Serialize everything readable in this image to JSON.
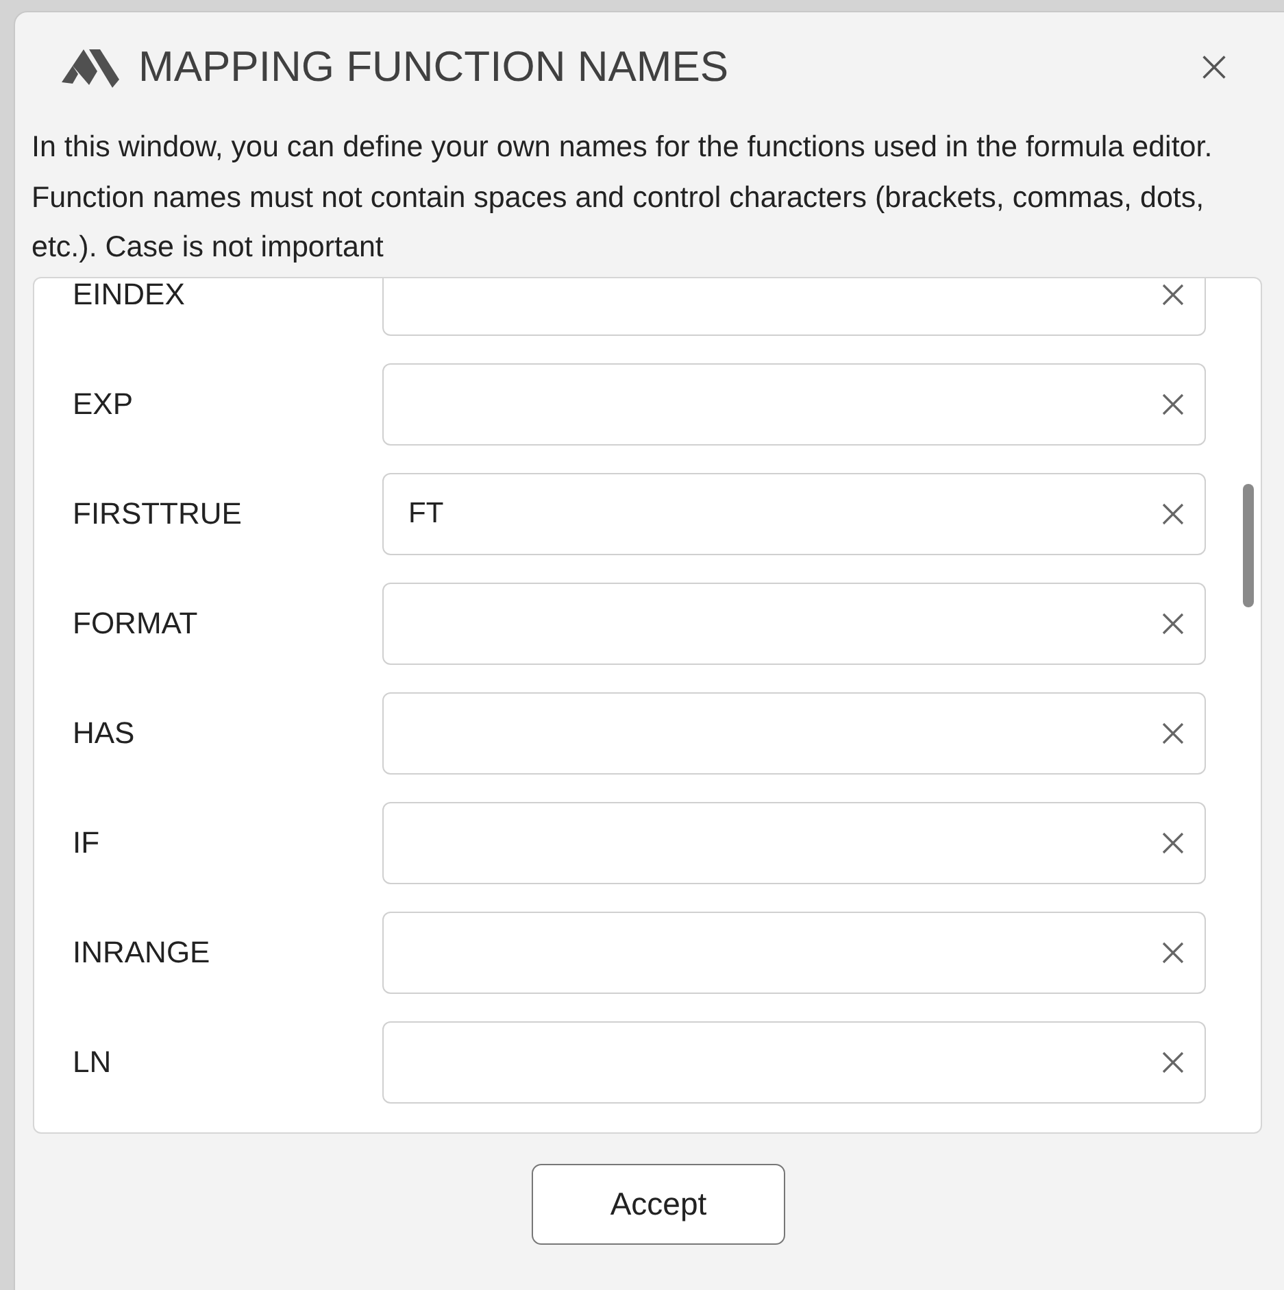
{
  "window": {
    "title": "MAPPING FUNCTION NAMES"
  },
  "description": "In this window, you can define your own names for the functions used in the formula editor. Function names must not contain spaces and control characters (brackets, commas, dots, etc.). Case is not important",
  "rows": [
    {
      "name": "EINDEX",
      "value": ""
    },
    {
      "name": "EXP",
      "value": ""
    },
    {
      "name": "FIRSTTRUE",
      "value": "FT"
    },
    {
      "name": "FORMAT",
      "value": ""
    },
    {
      "name": "HAS",
      "value": ""
    },
    {
      "name": "IF",
      "value": ""
    },
    {
      "name": "INRANGE",
      "value": ""
    },
    {
      "name": "LN",
      "value": ""
    }
  ],
  "buttons": [
    "Accept"
  ]
}
